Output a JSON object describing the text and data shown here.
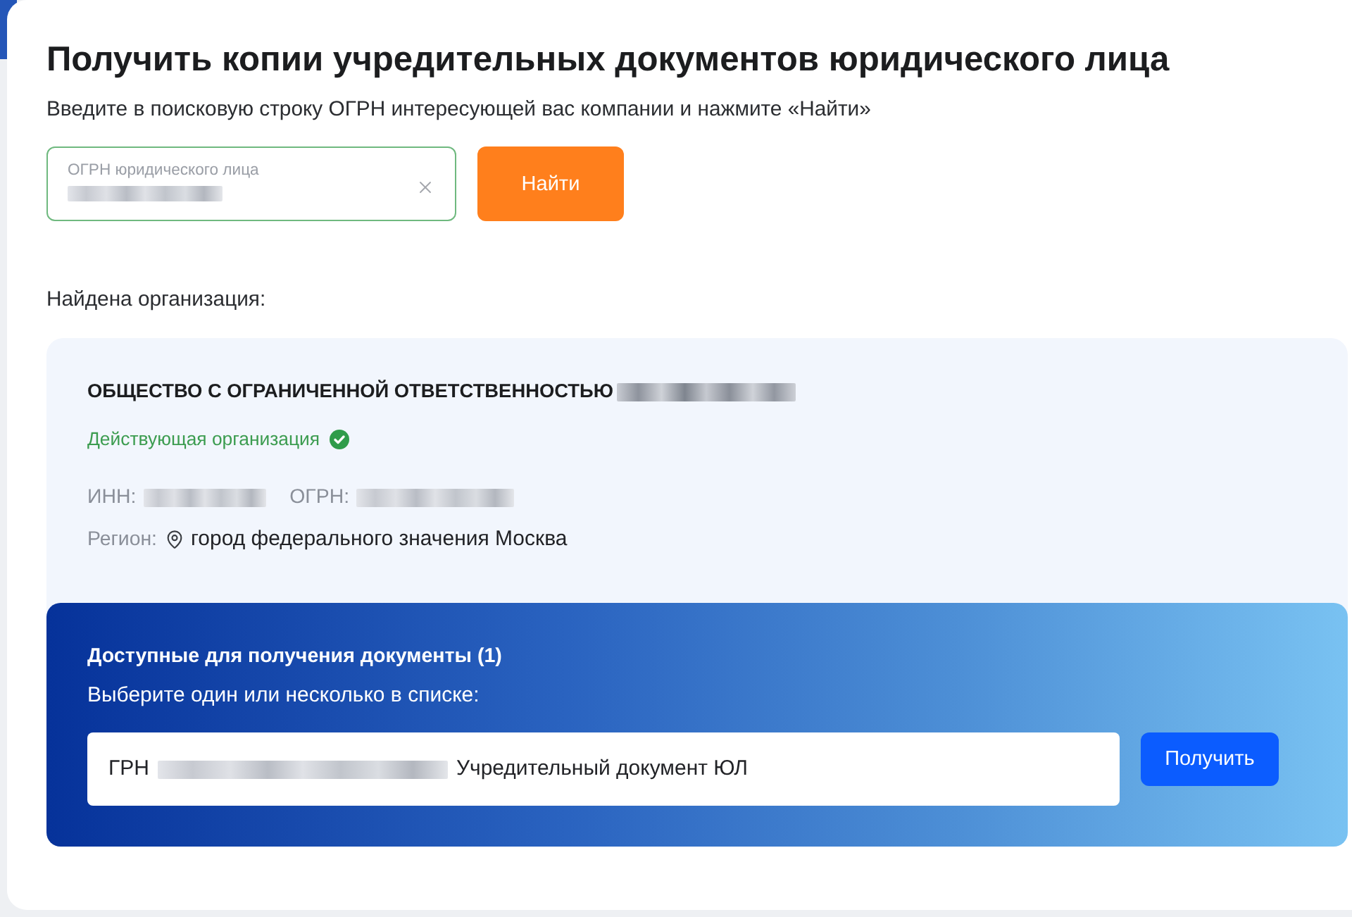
{
  "page": {
    "title": "Получить копии учредительных документов юридического лица",
    "subtitle": "Введите в поисковую строку ОГРН интересующей вас компании и нажмите «Найти»"
  },
  "search": {
    "label": "ОГРН юридического лица",
    "value_redacted": true,
    "button": "Найти"
  },
  "result_heading": "Найдена организация:",
  "organization": {
    "name": "ОБЩЕСТВО С ОГРАНИЧЕННОЙ ОТВЕТСТВЕННОСТЬЮ",
    "name_redacted": true,
    "status": "Действующая организация",
    "active": true,
    "fields": [
      {
        "label": "ИНН:",
        "redacted": true
      },
      {
        "label": "ОГРН:",
        "redacted": true
      }
    ],
    "region": {
      "label": "Регион:",
      "value": "город федерального значения Москва"
    }
  },
  "documents": {
    "title": "Доступные для получения документы (1)",
    "hint": "Выберите один или несколько в списке:",
    "items": [
      {
        "prefix": "ГРН",
        "redacted": true,
        "name": "Учредительный документ ЮЛ"
      }
    ],
    "button": "Получить"
  }
}
